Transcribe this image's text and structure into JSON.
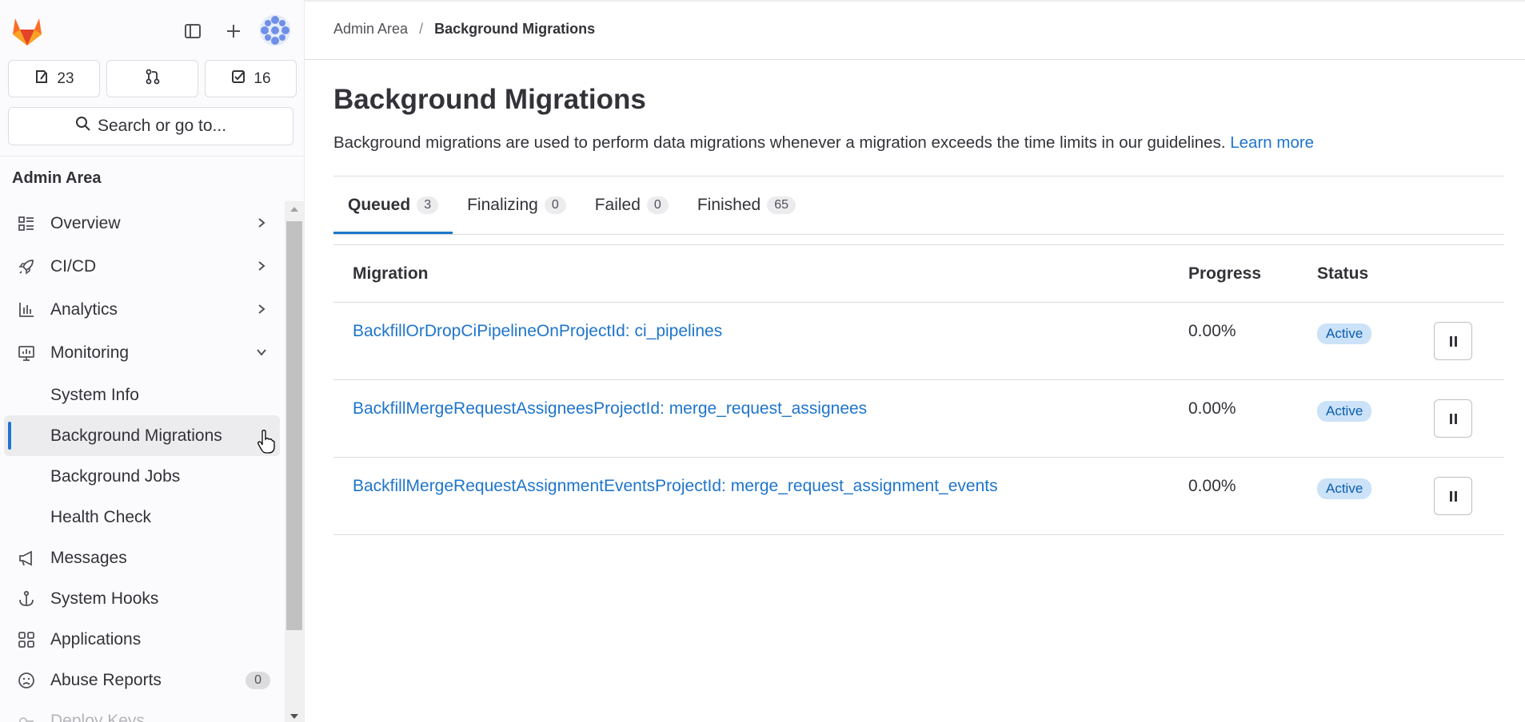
{
  "sidebar": {
    "counts": {
      "issues": "23",
      "merge_requests": "",
      "todos": "16"
    },
    "search_label": "Search or go to...",
    "section_title": "Admin Area",
    "items": [
      {
        "label": "Overview",
        "icon": "overview-icon",
        "chevron": "right"
      },
      {
        "label": "CI/CD",
        "icon": "rocket-icon",
        "chevron": "right"
      },
      {
        "label": "Analytics",
        "icon": "chart-icon",
        "chevron": "right"
      },
      {
        "label": "Monitoring",
        "icon": "monitor-icon",
        "chevron": "down"
      }
    ],
    "subitems": [
      {
        "label": "System Info"
      },
      {
        "label": "Background Migrations",
        "active": true
      },
      {
        "label": "Background Jobs"
      },
      {
        "label": "Health Check"
      }
    ],
    "items_after": [
      {
        "label": "Messages",
        "icon": "bullhorn-icon"
      },
      {
        "label": "System Hooks",
        "icon": "anchor-icon"
      },
      {
        "label": "Applications",
        "icon": "applications-icon"
      },
      {
        "label": "Abuse Reports",
        "icon": "abuse-icon",
        "badge": "0"
      },
      {
        "label": "Deploy Keys",
        "icon": "key-icon"
      }
    ]
  },
  "breadcrumb": {
    "parent": "Admin Area",
    "separator": "/",
    "current": "Background Migrations"
  },
  "page": {
    "title": "Background Migrations",
    "description": "Background migrations are used to perform data migrations whenever a migration exceeds the time limits in our guidelines.",
    "learn_more": "Learn more"
  },
  "tabs": [
    {
      "label": "Queued",
      "count": "3",
      "active": true
    },
    {
      "label": "Finalizing",
      "count": "0"
    },
    {
      "label": "Failed",
      "count": "0"
    },
    {
      "label": "Finished",
      "count": "65"
    }
  ],
  "table": {
    "headers": {
      "migration": "Migration",
      "progress": "Progress",
      "status": "Status"
    },
    "rows": [
      {
        "migration": "BackfillOrDropCiPipelineOnProjectId: ci_pipelines",
        "progress": "0.00%",
        "status": "Active"
      },
      {
        "migration": "BackfillMergeRequestAssigneesProjectId: merge_request_assignees",
        "progress": "0.00%",
        "status": "Active"
      },
      {
        "migration": "BackfillMergeRequestAssignmentEventsProjectId: merge_request_assignment_events",
        "progress": "0.00%",
        "status": "Active"
      }
    ]
  },
  "colors": {
    "accent": "#1f75cb",
    "badge_bg": "#cbe2f9",
    "badge_text": "#0b5cad",
    "logo": "#e24329"
  }
}
